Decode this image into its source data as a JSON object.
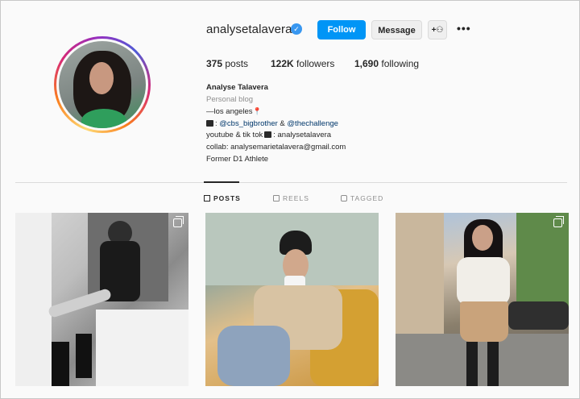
{
  "profile": {
    "username": "analysetalavera",
    "verified_glyph": "✓",
    "buttons": {
      "follow": "Follow",
      "message": "Message",
      "suggest": "+⚇"
    },
    "more_glyph": "•••",
    "stats": [
      {
        "count": "375",
        "label": "posts"
      },
      {
        "count": "122K",
        "label": "followers"
      },
      {
        "count": "1,690",
        "label": "following"
      }
    ],
    "bio": {
      "name": "Analyse Talavera",
      "category": "Personal blog",
      "location_line": "—los angeles",
      "shows_line_prefix": ": ",
      "shows_link_1": "@cbs_bigbrother",
      "shows_amp": " & ",
      "shows_link_2": "@thechallenge",
      "youtube_line": "youtube & tik tok",
      "youtube_suffix": ": analysetalavera",
      "collab_line": "collab: analysemarietalavera@gmail.com",
      "athlete_line": "Former D1 Athlete"
    }
  },
  "tabs": [
    {
      "label": "POSTS",
      "icon": "grid-icon",
      "active": true
    },
    {
      "label": "REELS",
      "icon": "reels-icon",
      "active": false
    },
    {
      "label": "TAGGED",
      "icon": "tag-icon",
      "active": false
    }
  ],
  "posts": [
    {
      "type": "multi-photo",
      "scene": "bathroom-mirror"
    },
    {
      "type": "photo",
      "scene": "cafe-coffee-cup"
    },
    {
      "type": "reel",
      "scene": "street"
    }
  ],
  "colors": {
    "accent": "#0095f6",
    "verified": "#3897f0",
    "link": "#00376b",
    "muted": "#8e8e8e"
  }
}
